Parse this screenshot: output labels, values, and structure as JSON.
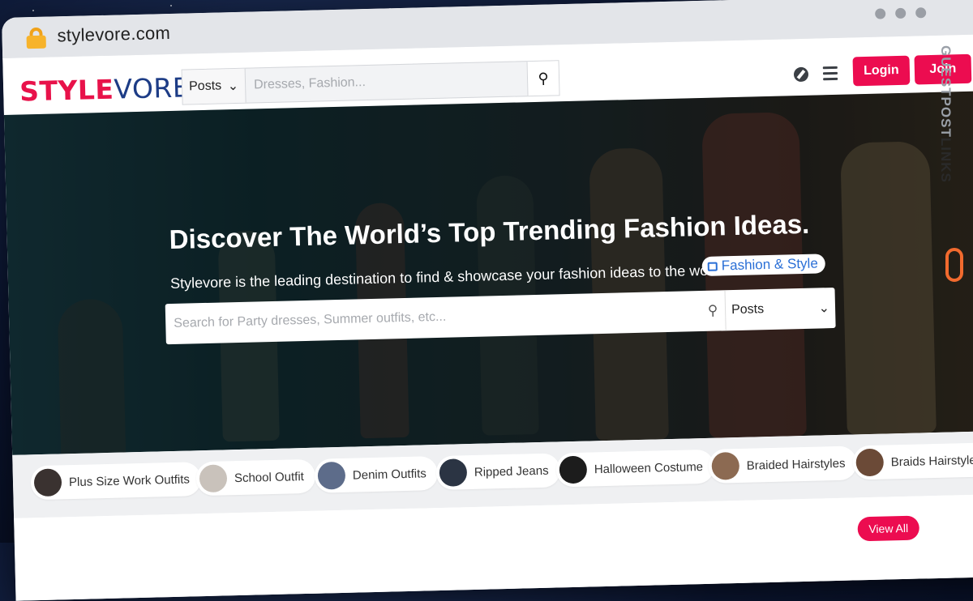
{
  "browser": {
    "url": "stylevore.com"
  },
  "navbar": {
    "logo_part1": "STYLE",
    "logo_part2": "VORE",
    "search_type": "Posts",
    "search_placeholder": "Dresses, Fashion...",
    "login_label": "Login",
    "join_label": "Join"
  },
  "hero": {
    "title": "Discover The World’s Top Trending Fashion Ideas.",
    "subtitle": "Stylevore is the leading destination to find & showcase your fashion ideas to the world.",
    "tag": "Fashion & Style",
    "search_placeholder": "Search for Party dresses, Summer outfits, etc...",
    "search_type": "Posts"
  },
  "chips": [
    {
      "label": "Plus Size Work Outfits",
      "color": "#3a3230"
    },
    {
      "label": "School Outfit",
      "color": "#c9c2bb"
    },
    {
      "label": "Denim Outfits",
      "color": "#5d6c8a"
    },
    {
      "label": "Ripped Jeans",
      "color": "#2b3443"
    },
    {
      "label": "Halloween Costume",
      "color": "#1c1c1c"
    },
    {
      "label": "Braided Hairstyles",
      "color": "#8c6a52"
    },
    {
      "label": "Braids Hairstyles",
      "color": "#6b4a37"
    }
  ],
  "content": {
    "view_all_label": "View All"
  },
  "watermark": {
    "text_part1": "GUESTPOST",
    "text_part2": "LINKS"
  },
  "colors": {
    "brand_pink": "#ec0c50",
    "brand_navy": "#1d3c86",
    "link_blue": "#2a6fd6",
    "watermark_orange": "#f26a2e"
  }
}
